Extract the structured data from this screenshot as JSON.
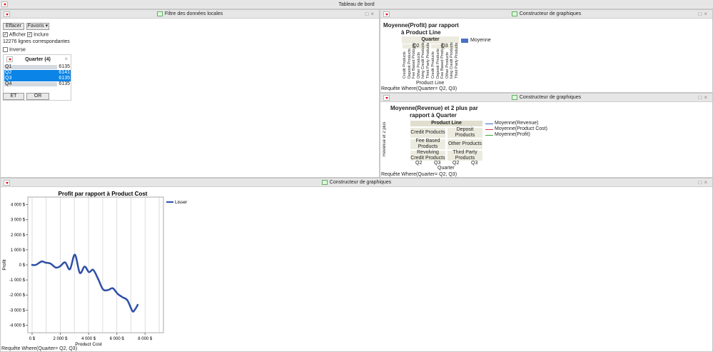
{
  "window": {
    "title": "Tableau de bord"
  },
  "filter_panel": {
    "title": "Filtre des données locales",
    "clear_label": "Effacer",
    "favorites_label": "Favoris ▾",
    "show_label": "Afficher",
    "include_label": "Inclure",
    "matching_rows": "12276 lignes correspondantes",
    "inverse_label": "Inverse",
    "list_title": "Quarter (4)",
    "items": [
      {
        "label": "Q1",
        "count": "6135",
        "selected": false
      },
      {
        "label": "Q2",
        "count": "6141",
        "selected": true
      },
      {
        "label": "Q3",
        "count": "6135",
        "selected": true
      },
      {
        "label": "Q4",
        "count": "6135",
        "selected": false
      }
    ],
    "and_label": "ET",
    "or_label": "OR"
  },
  "graph1": {
    "panel_title": "Constructeur de graphiques",
    "title_line1": "Moyenne(Profit) par rapport",
    "title_line2": "à Product Line",
    "group_header": "Quarter",
    "groups": [
      "Q2",
      "Q3"
    ],
    "categories": [
      "Credit Products",
      "Deposit Products",
      "Fee Based Products",
      "Other Products",
      "lving Credit Products",
      "Third Party Products"
    ],
    "xlabel": "Product Line",
    "legend": "Moyenne",
    "where": "Requête Where(Quarter= Q2, Q3)",
    "color": "#4a6fc6"
  },
  "graph2": {
    "panel_title": "Constructeur de graphiques",
    "title_line1": "Moyenne(Revenue) et 2 plus par",
    "title_line2": "rapport à Quarter",
    "header": "Product Line",
    "cells": [
      "Credit Products",
      "Deposit Products",
      "Fee Based Products",
      "Other Products",
      "Revolving Credit Products",
      "Third Party Products"
    ],
    "xticks": [
      "Q2",
      "Q3",
      "Q2",
      "Q3"
    ],
    "xlabel": "Quarter",
    "ylabel": "Revenue et 2 plus",
    "legend": [
      {
        "label": "Moyenne(Revenue)",
        "color": "#3b5fd6"
      },
      {
        "label": "Moyenne(Product Cost)",
        "color": "#d63b4a"
      },
      {
        "label": "Moyenne(Profit)",
        "color": "#3aa53a"
      }
    ],
    "where": "Requête Where(Quarter= Q2, Q3)"
  },
  "graph3": {
    "panel_title": "Constructeur de graphiques",
    "where": "Requête Where(Quarter= Q2, Q3)"
  },
  "chart_data": {
    "type": "line",
    "title": "Profit par rapport à Product Cost",
    "xlabel": "Product Cost",
    "ylabel": "Profit",
    "xlim": [
      -300,
      9300
    ],
    "ylim": [
      -4500,
      4500
    ],
    "grid": true,
    "legend": "top-right",
    "legend_entries": [
      "Lisser"
    ],
    "xticks": [
      {
        "v": 0,
        "label": "0 $"
      },
      {
        "v": 2000,
        "label": "2 000 $"
      },
      {
        "v": 4000,
        "label": "4 000 $"
      },
      {
        "v": 6000,
        "label": "6 000 $"
      },
      {
        "v": 8000,
        "label": "8 000 $"
      }
    ],
    "yticks": [
      {
        "v": 4000,
        "label": "4 000 $"
      },
      {
        "v": 3000,
        "label": "3 000 $"
      },
      {
        "v": 2000,
        "label": "2 000 $"
      },
      {
        "v": 1000,
        "label": "1 000 $"
      },
      {
        "v": 0,
        "label": "0 $"
      },
      {
        "v": -1000,
        "label": "-1 000 $"
      },
      {
        "v": -2000,
        "label": "-2 000 $"
      },
      {
        "v": -3000,
        "label": "-3 000 $"
      },
      {
        "v": -4000,
        "label": "-4 000 $"
      }
    ],
    "series": [
      {
        "name": "Lisser",
        "color": "#2e4fa6",
        "x": [
          0,
          260,
          690,
          950,
          1300,
          1680,
          2000,
          2340,
          2680,
          3030,
          3380,
          3720,
          4030,
          4330,
          4680,
          5020,
          5370,
          5710,
          6060,
          6410,
          6750,
          7100,
          7270,
          7480
        ],
        "y": [
          0,
          0,
          230,
          150,
          90,
          -180,
          -80,
          170,
          -290,
          680,
          -530,
          -110,
          -480,
          -330,
          -940,
          -1620,
          -1670,
          -1550,
          -1920,
          -2150,
          -2350,
          -3060,
          -2980,
          -2650
        ]
      }
    ]
  }
}
